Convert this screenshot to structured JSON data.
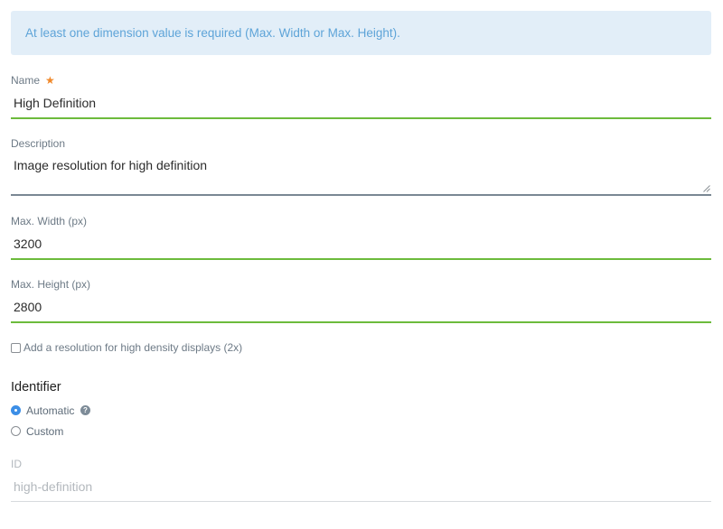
{
  "alert": {
    "message": "At least one dimension value is required (Max. Width or Max. Height)."
  },
  "form": {
    "name": {
      "label": "Name",
      "required_mark": "★",
      "value": "High Definition"
    },
    "description": {
      "label": "Description",
      "value": "Image resolution for high definition"
    },
    "max_width": {
      "label": "Max. Width (px)",
      "value": "3200"
    },
    "max_height": {
      "label": "Max. Height (px)",
      "value": "2800"
    },
    "high_density": {
      "label": "Add a resolution for high density displays (2x)",
      "checked": false
    },
    "identifier": {
      "title": "Identifier",
      "options": [
        {
          "label": "Automatic",
          "selected": true
        },
        {
          "label": "Custom",
          "selected": false
        }
      ],
      "help_glyph": "?"
    },
    "id": {
      "label": "ID",
      "placeholder": "high-definition"
    }
  },
  "colors": {
    "alert_bg": "#e2eef8",
    "alert_text": "#5ea4d8",
    "valid_border": "#6cbb3c",
    "required_star": "#f0892b",
    "radio_selected": "#3c8ee6"
  },
  "icons": [
    "required-star-icon",
    "resize-handle-icon",
    "help-icon"
  ]
}
